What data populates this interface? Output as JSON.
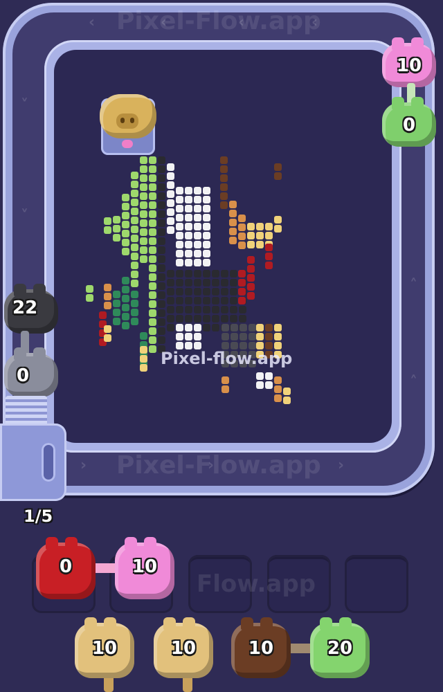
{
  "watermarks": {
    "top_belt": "Pixel-Flow.app",
    "bottom_belt": "Pixel-Flow.app",
    "center": "Pixel-flow.app",
    "tray": "Flow.app"
  },
  "progress": "1/5",
  "track_pigs": [
    {
      "id": "pink-top-right",
      "count": "10",
      "color": "#f08ad8"
    },
    {
      "id": "green-right",
      "count": "0",
      "color": "#7fcf6c"
    },
    {
      "id": "black-left",
      "count": "22",
      "color": "#3a3a40"
    },
    {
      "id": "gray-left",
      "count": "0",
      "color": "#8a8d9c"
    }
  ],
  "tray_pigs": [
    {
      "id": "red-slot1",
      "count": "0",
      "color": "#c81f25"
    },
    {
      "id": "pink-slot2",
      "count": "10",
      "color": "#f08ad8"
    }
  ],
  "queue_pigs": [
    {
      "id": "tan-1",
      "count": "10",
      "color": "#e2c17c"
    },
    {
      "id": "tan-2",
      "count": "10",
      "color": "#e2c17c"
    },
    {
      "id": "brown-3",
      "count": "10",
      "color": "#6b3d24"
    },
    {
      "id": "green-4",
      "count": "20",
      "color": "#84d46e"
    }
  ],
  "colors": {
    "background": "#2f2b55",
    "track": "#9aa3dc",
    "board": "#2c2853",
    "golden_pig": "#d9b25c"
  }
}
